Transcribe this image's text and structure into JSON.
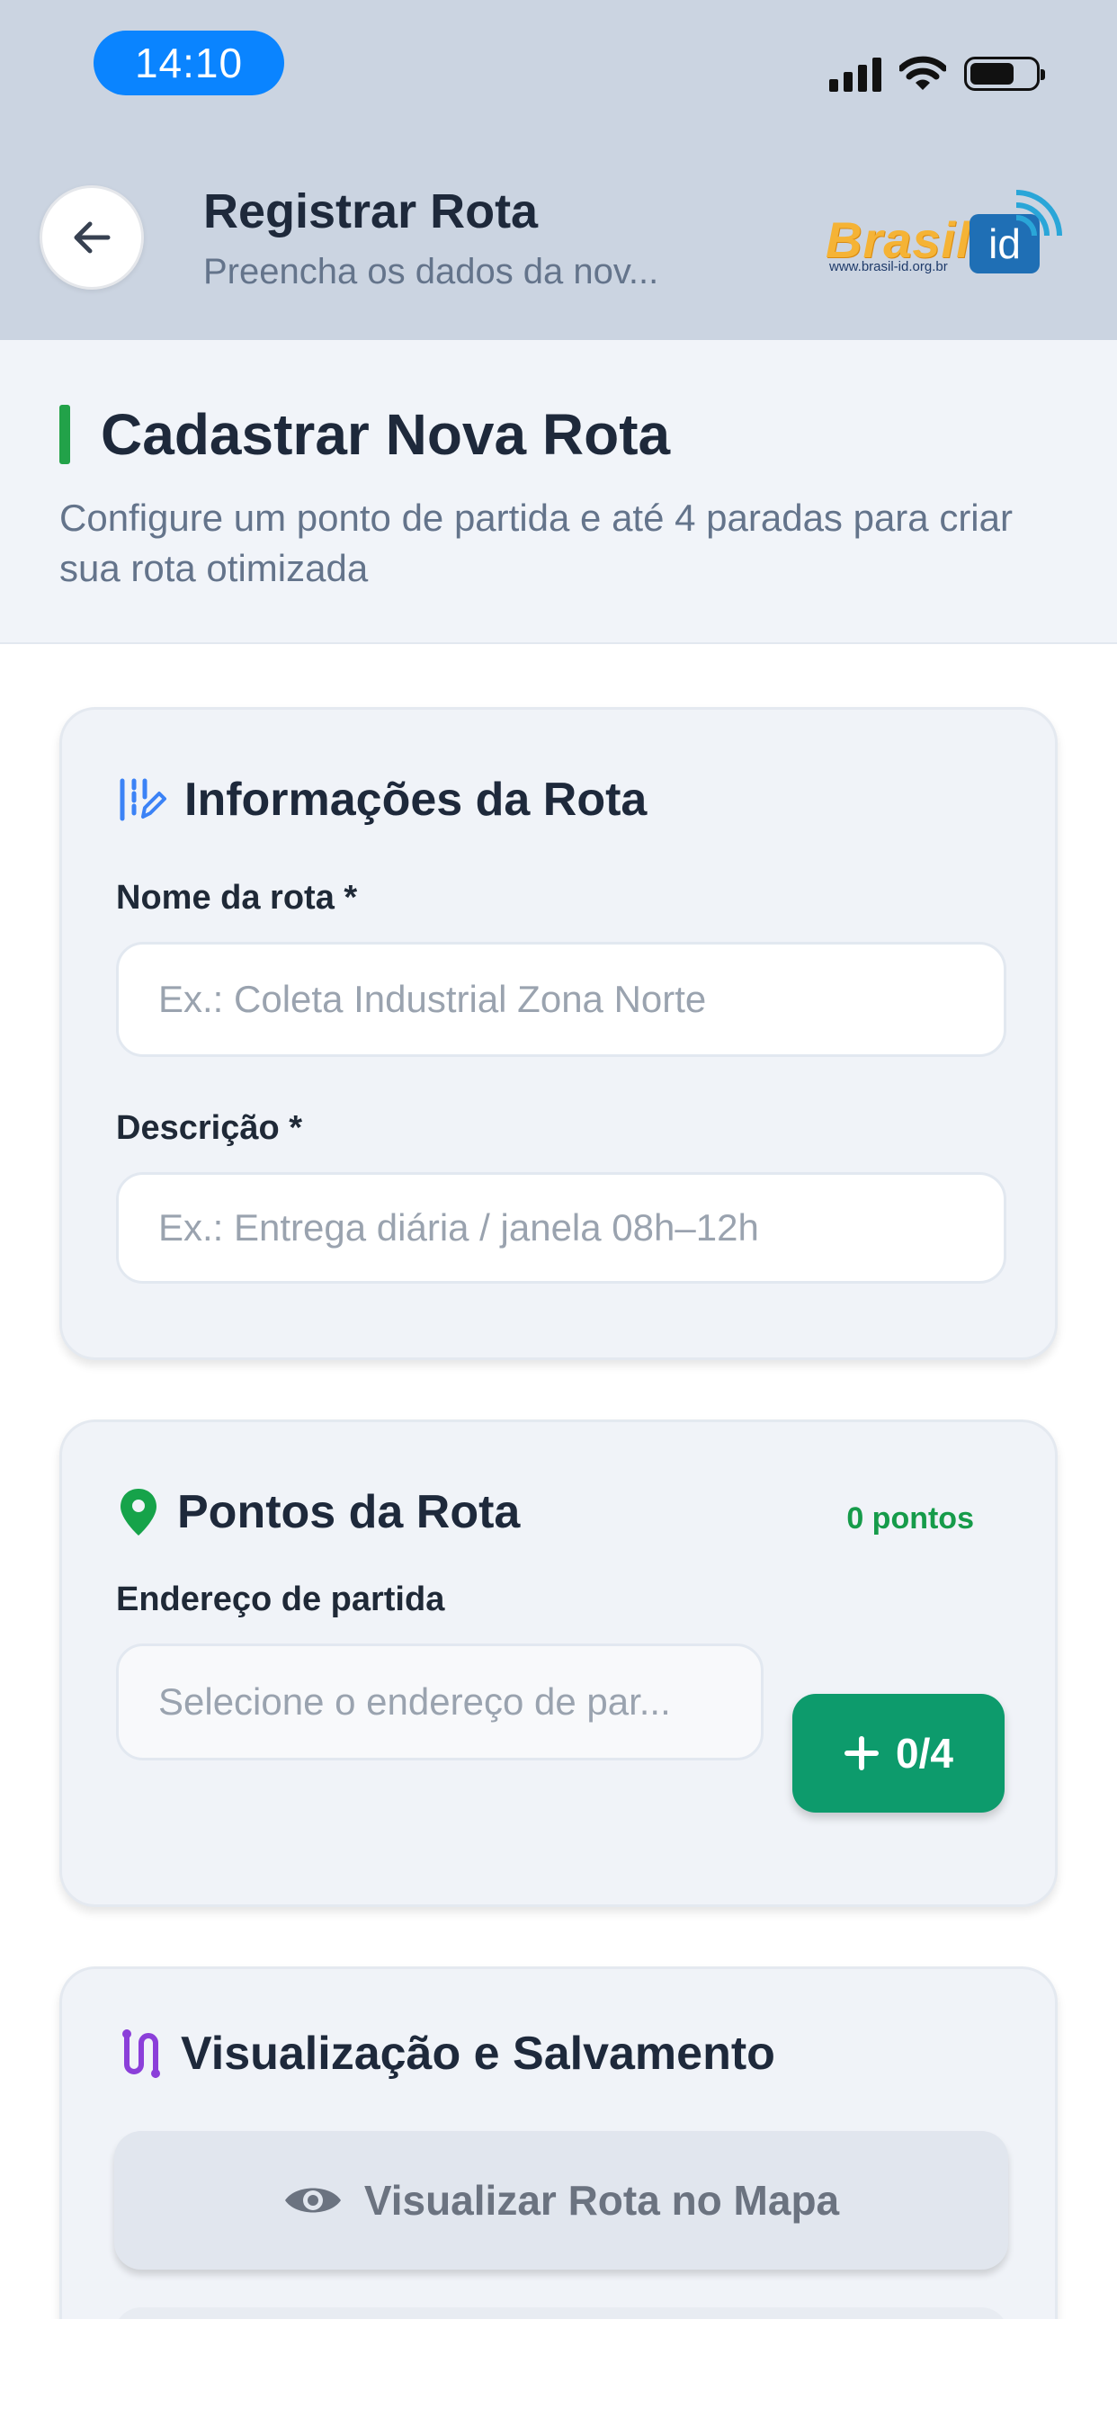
{
  "status_bar": {
    "time": "14:10"
  },
  "header": {
    "title": "Registrar Rota",
    "subtitle": "Preencha os dados da nov...",
    "logo_text": "Brasil",
    "logo_id": "id",
    "logo_url": "www.brasil-id.org.br"
  },
  "intro": {
    "title": "Cadastrar Nova Rota",
    "description": "Configure um ponto de partida e até 4 paradas para criar sua rota otimizada"
  },
  "route_info": {
    "title": "Informações da Rota",
    "name_label": "Nome da rota *",
    "name_placeholder": "Ex.: Coleta Industrial Zona Norte",
    "desc_label": "Descrição *",
    "desc_placeholder": "Ex.: Entrega diária / janela 08h–12h"
  },
  "route_points": {
    "title": "Pontos da Rota",
    "count_badge": "0 pontos",
    "start_label": "Endereço de partida",
    "start_placeholder": "Selecione o endereço de par...",
    "add_button": "0/4"
  },
  "save_section": {
    "title": "Visualização e Salvamento",
    "map_button": "Visualizar Rota no Mapa"
  },
  "colors": {
    "accent_green": "#0d9b6c",
    "header_bg": "#cbd4e1",
    "pill_blue": "#0a84ff"
  }
}
